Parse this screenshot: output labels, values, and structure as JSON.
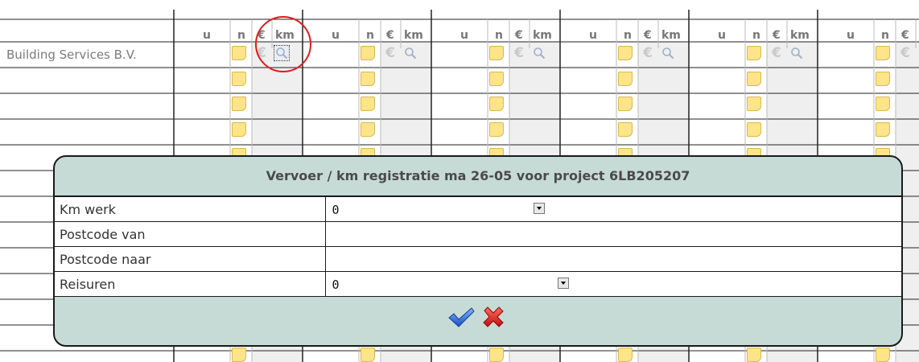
{
  "grid": {
    "column_headers": [
      "u",
      "n",
      "€",
      "km"
    ],
    "day_group_count": 6,
    "row_labels": [
      "Building Services B.V."
    ]
  },
  "icons": {
    "note": "note-icon",
    "euro": "euro-icon",
    "km": "magnifier-icon"
  },
  "dialog": {
    "title": "Vervoer / km registratie ma 26-05 voor project 6LB205207",
    "fields": [
      {
        "label": "Km werk",
        "value": "0",
        "type": "select"
      },
      {
        "label": "Postcode van",
        "value": "",
        "type": "text"
      },
      {
        "label": "Postcode naar",
        "value": "",
        "type": "text"
      },
      {
        "label": "Reisuren",
        "value": "0",
        "type": "select"
      }
    ],
    "confirm_icon": "checkmark-icon",
    "cancel_icon": "red-x-icon"
  },
  "colors": {
    "dialog_bg": "#c7dbd6",
    "note_yellow": "#ffe48a",
    "highlight": "#e01b1b",
    "column_shade": "#efefef"
  }
}
